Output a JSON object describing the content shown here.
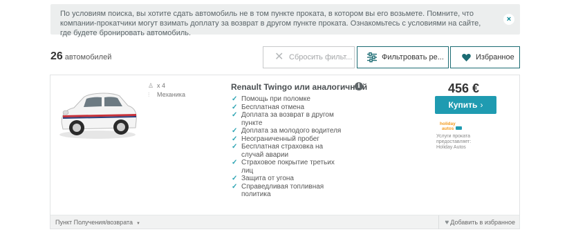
{
  "notice": {
    "text": "По условиям поиска, вы хотите сдать автомобиль не в том пункте проката, в котором вы его возьмете. Помните, что компании-прокатчики могут взимать доплату за возврат в другом пункте проката. Ознакомьтесь с условиями на сайте, где будете бронировать автомобиль.",
    "close_icon": "×"
  },
  "results": {
    "count": "26",
    "count_label": "автомобилей"
  },
  "toolbar": {
    "reset_label": "Сбросить фильт...",
    "filter_label": "Фильтровать ре...",
    "favorites_label": "Избранное"
  },
  "car": {
    "title": "Renault Twingo или аналогичный",
    "seats": "x 4",
    "transmission": "Механика",
    "features": [
      "Помощь при поломке",
      "Бесплатная отмена",
      "Доплата за возврат в другом пункте",
      "Доплата за молодого водителя",
      "Неограниченный пробег",
      "Бесплатная страховка на случай аварии",
      "Страховое покрытие третьих лиц",
      "Защита от угона",
      "Справедливая топливная политика"
    ],
    "price": "456 €",
    "buy_label": "Купить",
    "supplier_label": "Услуги проката предоставляет:",
    "supplier_name": "Holiday Autos",
    "supplier_logo_text": "holiday autos"
  },
  "footer": {
    "pickup_label": "Пункт Получения/возврата",
    "add_favorite_label": "Добавить в избранное"
  },
  "colors": {
    "accent": "#1f9bb1",
    "border_dark": "#1b6b73",
    "check": "#2aa3b2"
  }
}
